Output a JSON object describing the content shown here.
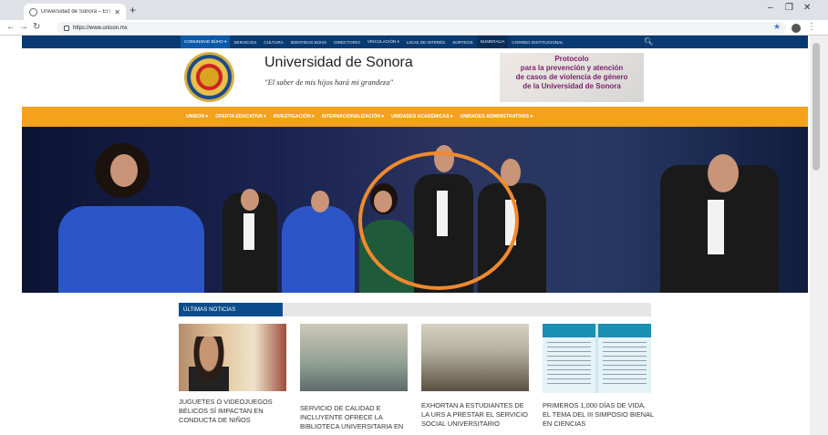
{
  "browser": {
    "tab_title": "Universidad de Sonora – El saber...",
    "url": "https://www.unison.mx"
  },
  "top_nav": [
    "Comunidad búho ▾",
    "Servicios",
    "Cultura",
    "Identidad búho",
    "Directorio",
    "Vinculación ▾",
    "Ligas de interés",
    "Sorteos",
    "Numeralia",
    "Correo institucional"
  ],
  "header": {
    "university_name": "Universidad de Sonora",
    "motto": "\"El saber de mis hijos hará mi grandeza\"",
    "protocol_banner": [
      "Protocolo",
      "para la prevención y atención",
      "de casos de violencia de género",
      "de la Universidad de Sonora"
    ]
  },
  "main_nav": [
    "UNISON ▾",
    "OFERTA EDUCATIVA ▾",
    "INVESTIGACIÓN ▾",
    "INTERNACIONALIZACIÓN ▾",
    "UNIDADES ACADÉMICAS ▾",
    "UNIDADES ADMINISTRATIVAS ▾"
  ],
  "news": {
    "section_title": "Últimas noticias",
    "items": [
      {
        "headline": "JUGUETES O VIDEOJUEGOS BÉLICOS SÍ IMPACTAN EN CONDUCTA DE NIÑOS"
      },
      {
        "headline": "SERVICIO DE CALIDAD E INCLUYENTE OFRECE LA BIBLIOTECA UNIVERSITARIA EN"
      },
      {
        "headline": "EXHORTAN A ESTUDIANTES DE LA URS A PRESTAR EL SERVICIO SOCIAL UNIVERSITARIO"
      },
      {
        "headline": "PRIMEROS 1,000 DÍAS DE VIDA, EL TEMA DEL III SIMPOSIO BIENAL EN CIENCIAS"
      }
    ]
  },
  "colors": {
    "top_bar": "#0a3a72",
    "main_nav_bar": "#f4a21b",
    "news_tag": "#0b4c8c",
    "annotation_circle": "#f08a2e"
  },
  "icons": {
    "window": [
      "minimize-icon",
      "maximize-icon",
      "close-icon"
    ],
    "toolbar": [
      "back-icon",
      "forward-icon",
      "reload-icon",
      "lock-icon",
      "star-icon",
      "profile-icon",
      "menu-icon"
    ]
  }
}
